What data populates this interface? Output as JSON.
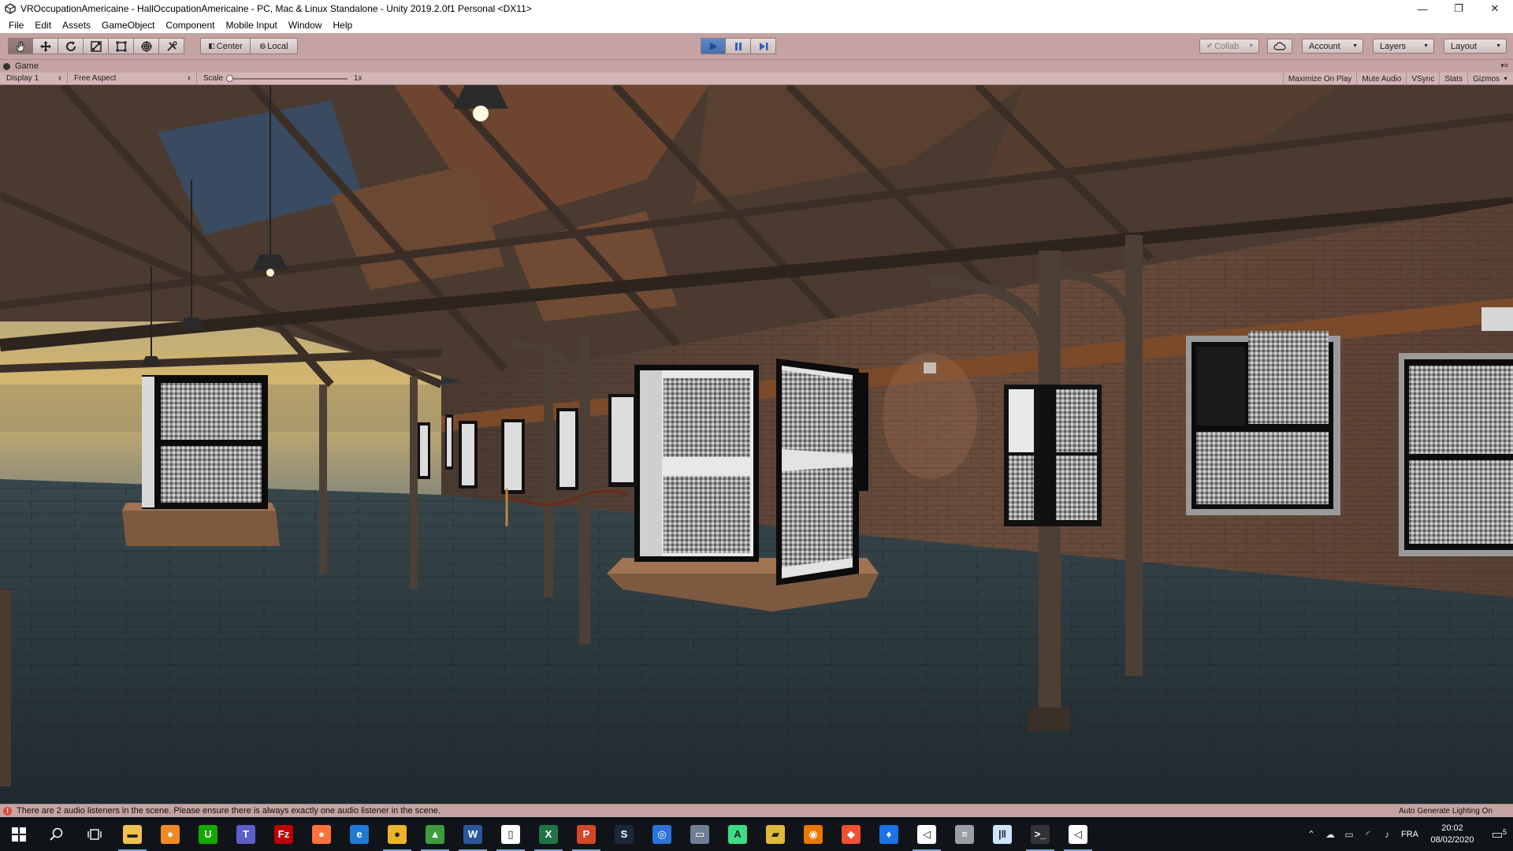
{
  "window": {
    "title": "VROccupationAmericaine - HallOccupationAmericaine - PC, Mac & Linux Standalone - Unity 2019.2.0f1 Personal <DX11>",
    "controls": [
      "—",
      "❐",
      "✕"
    ]
  },
  "menu": [
    "File",
    "Edit",
    "Assets",
    "GameObject",
    "Component",
    "Mobile Input",
    "Window",
    "Help"
  ],
  "toolbar": {
    "tools": [
      "hand-icon",
      "move-icon",
      "rotate-icon",
      "scale-icon",
      "rect-icon",
      "transform-icon",
      "custom-tool-icon"
    ],
    "pivot_label": "Center",
    "space_label": "Local",
    "collab_label": "Collab",
    "account_label": "Account",
    "layers_label": "Layers",
    "layout_label": "Layout",
    "accent_play": "#4a78b8"
  },
  "game_tab": {
    "label": "Game"
  },
  "game_toolbar": {
    "display": "Display 1",
    "aspect": "Free Aspect",
    "scale_label": "Scale",
    "scale_value": "1x",
    "buttons": [
      "Maximize On Play",
      "Mute Audio",
      "VSync",
      "Stats",
      "Gizmos"
    ]
  },
  "status": {
    "message": "There are 2 audio listeners in the scene. Please ensure there is always exactly one audio listener in the scene.",
    "right": "Auto Generate Lighting On"
  },
  "taskbar": {
    "apps": [
      {
        "name": "file-explorer",
        "glyph": "▬",
        "color": "#f2c14e"
      },
      {
        "name": "app-orange",
        "glyph": "●",
        "color": "#f08a24"
      },
      {
        "name": "upwork",
        "glyph": "U",
        "color": "#14a800"
      },
      {
        "name": "teams",
        "glyph": "T",
        "color": "#5b5fc7"
      },
      {
        "name": "filezilla",
        "glyph": "Fz",
        "color": "#bf0000"
      },
      {
        "name": "firefox",
        "glyph": "●",
        "color": "#ff7139"
      },
      {
        "name": "edge",
        "glyph": "e",
        "color": "#1f7ad6"
      },
      {
        "name": "chrome",
        "glyph": "●",
        "color": "#e9b42a"
      },
      {
        "name": "image-editor",
        "glyph": "▲",
        "color": "#3c9d3c"
      },
      {
        "name": "word",
        "glyph": "W",
        "color": "#2b579a"
      },
      {
        "name": "document",
        "glyph": "▯",
        "color": "#ffffff"
      },
      {
        "name": "excel",
        "glyph": "X",
        "color": "#217346"
      },
      {
        "name": "powerpoint",
        "glyph": "P",
        "color": "#d24726"
      },
      {
        "name": "steam",
        "glyph": "S",
        "color": "#1b2838"
      },
      {
        "name": "ubisoft",
        "glyph": "◎",
        "color": "#2b73d8"
      },
      {
        "name": "window-app",
        "glyph": "▭",
        "color": "#6d7f95"
      },
      {
        "name": "android",
        "glyph": "A",
        "color": "#3ddc84"
      },
      {
        "name": "clapper",
        "glyph": "▰",
        "color": "#e0b83a"
      },
      {
        "name": "blender",
        "glyph": "◉",
        "color": "#ea7600"
      },
      {
        "name": "git",
        "glyph": "◆",
        "color": "#f05033"
      },
      {
        "name": "maps",
        "glyph": "♦",
        "color": "#1a73e8"
      },
      {
        "name": "unity-hub",
        "glyph": "◁",
        "color": "#ffffff"
      },
      {
        "name": "database",
        "glyph": "≡",
        "color": "#9aa0a6"
      },
      {
        "name": "tool-bars",
        "glyph": "|‖",
        "color": "#d0e4ff"
      },
      {
        "name": "terminal",
        "glyph": ">_",
        "color": "#333333"
      },
      {
        "name": "unity-editor",
        "glyph": "◁",
        "color": "#ffffff"
      }
    ],
    "language": "FRA",
    "time": "20:02",
    "date": "08/02/2020",
    "notifications": "5"
  }
}
